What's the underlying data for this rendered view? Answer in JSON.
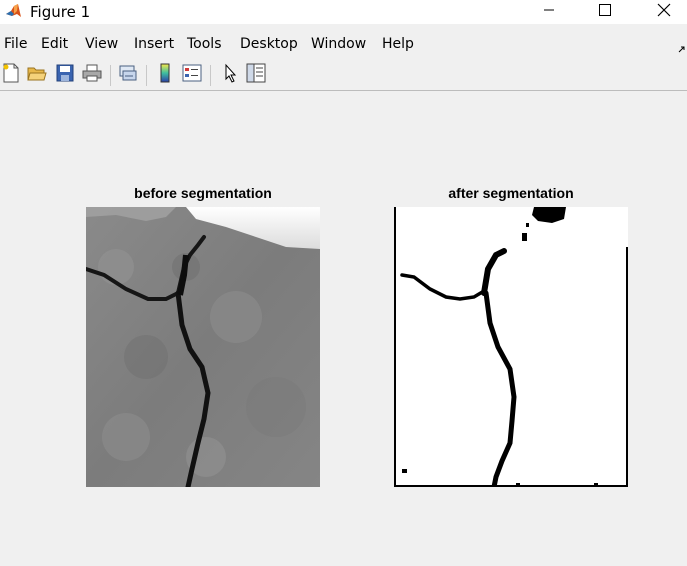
{
  "window": {
    "title": "Figure 1",
    "controls": [
      "minimize",
      "maximize",
      "close"
    ]
  },
  "menu": {
    "items": [
      "File",
      "Edit",
      "View",
      "Insert",
      "Tools",
      "Desktop",
      "Window",
      "Help"
    ]
  },
  "toolbar": {
    "icons": [
      "new-figure-icon",
      "open-file-icon",
      "save-icon",
      "print-icon",
      "link-plot-icon",
      "insert-colorbar-icon",
      "insert-legend-icon",
      "edit-plot-icon",
      "property-inspector-icon"
    ]
  },
  "axes": [
    {
      "title": "before segmentation",
      "content": "grayscale photo of a cracked surface"
    },
    {
      "title": "after segmentation",
      "content": "binary mask of the crack"
    }
  ],
  "colors": {
    "figure_background": "#f0f0f0",
    "titlebar": "#ffffff",
    "matlab_orange": "#d95319"
  }
}
